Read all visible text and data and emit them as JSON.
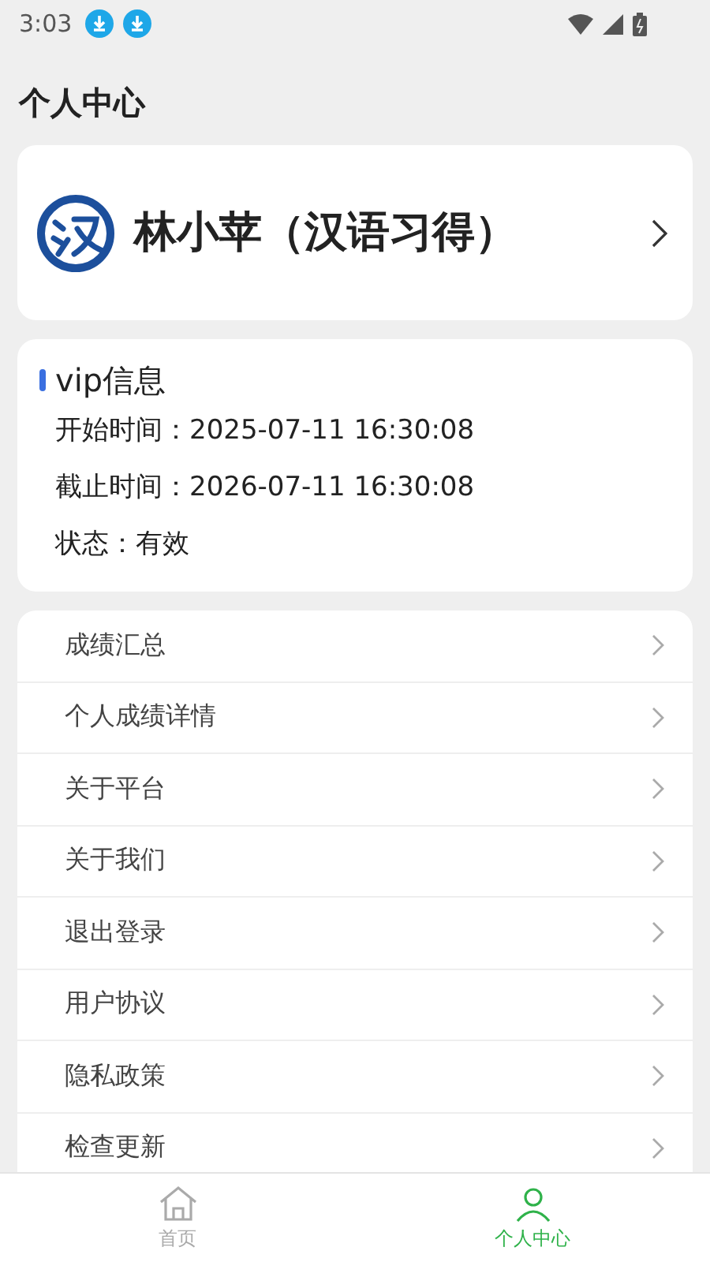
{
  "status_bar": {
    "time": "3:03"
  },
  "page_title": "个人中心",
  "profile": {
    "name": "林小苹（汉语习得）"
  },
  "vip": {
    "title": "vip信息",
    "lines": [
      {
        "label": "开始时间：",
        "value": "2025-07-11 16:30:08"
      },
      {
        "label": "截止时间：",
        "value": "2026-07-11 16:30:08"
      },
      {
        "label": "状态：",
        "value": "有效"
      }
    ]
  },
  "menu": [
    "成绩汇总",
    "个人成绩详情",
    "关于平台",
    "关于我们",
    "退出登录",
    "用户协议",
    "隐私政策",
    "检查更新"
  ],
  "tabs": [
    {
      "label": "首页",
      "selected": false,
      "kind": "home"
    },
    {
      "label": "个人中心",
      "selected": true,
      "kind": "person"
    }
  ]
}
